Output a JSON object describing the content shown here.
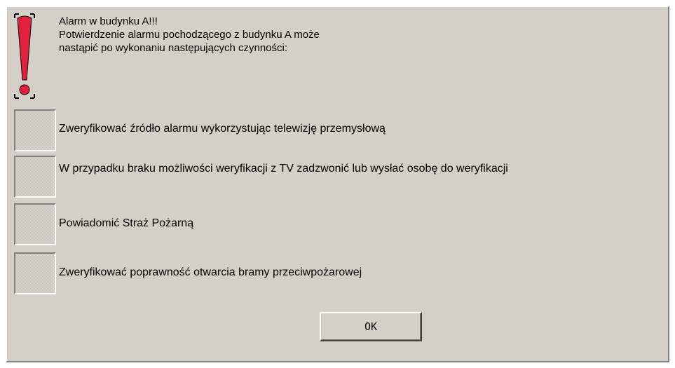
{
  "dialog": {
    "icon": "exclamation-icon",
    "header_lines": [
      "Alarm w budynku A!!!",
      "Potwierdzenie alarmu pochodzącego z budynku A może",
      "nastąpić po wykonaniu następujących czynności:"
    ],
    "tasks": [
      {
        "label": "Zweryfikować źródło alarmu wykorzystując telewizję przemysłową",
        "checked": false
      },
      {
        "label": "W przypadku braku możliwości weryfikacji z TV zadzwonić lub wysłać osobę do weryfikacji",
        "checked": false
      },
      {
        "label": "Powiadomić Straż Pożarną",
        "checked": false
      },
      {
        "label": "Zweryfikować poprawność otwarcia bramy przeciwpożarowej",
        "checked": false
      }
    ],
    "ok_label": "OK",
    "colors": {
      "background": "#d4d0c8",
      "icon_red": "#e0203c"
    }
  }
}
